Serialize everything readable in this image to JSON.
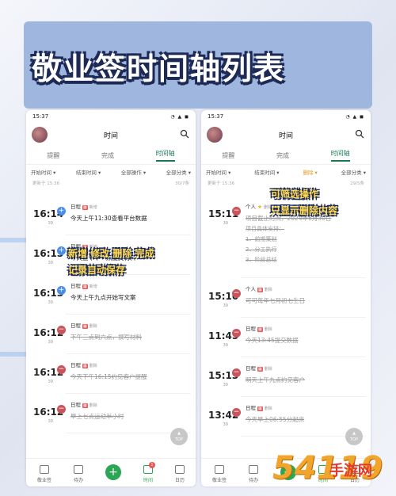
{
  "banner_title": "敬业签时间轴列表",
  "phone_left": {
    "status_time": "15:37",
    "header_title": "时间",
    "tabs": [
      "提醒",
      "完成",
      "时间轴"
    ],
    "filters": [
      "开始时间 ▾",
      "结束时间 ▾",
      "全部操作 ▾",
      "全部分类 ▾"
    ],
    "update_left": "更新于 15:36",
    "update_right": "30/7条",
    "rows": [
      {
        "time": "16:14",
        "day": "39",
        "type": "add",
        "label": "日程",
        "status": "新增",
        "text": "今天上午11:30查看平台数据"
      },
      {
        "time": "16:13",
        "day": "39",
        "type": "add",
        "label": "日程",
        "status": "新增",
        "text": "今天上午十一点提交材料"
      },
      {
        "time": "16:13",
        "day": "39",
        "type": "add",
        "label": "日程",
        "status": "新增",
        "text": "今天上午九点开始写文案"
      },
      {
        "time": "16:12",
        "day": "39",
        "type": "del",
        "label": "日程",
        "status": "删除",
        "text": "下午三点到六点，撰写材料"
      },
      {
        "time": "16:12",
        "day": "39",
        "type": "del",
        "label": "日程",
        "status": "删除",
        "text": "今天下午16:15约见客户提醒"
      },
      {
        "time": "16:12",
        "day": "39",
        "type": "del",
        "label": "日程",
        "status": "删除",
        "text": "早上七点运动半小时"
      }
    ],
    "annotation_1": "新增 修改 删除 完成",
    "annotation_2": "记录自动保存",
    "nav": [
      "敬业签",
      "待办",
      "",
      "时间",
      "日历"
    ],
    "badge": "1"
  },
  "phone_right": {
    "status_time": "15:37",
    "header_title": "时间",
    "tabs": [
      "提醒",
      "完成",
      "时间轴"
    ],
    "filters": [
      "开始时间 ▾",
      "结束时间 ▾",
      "删除 ▾",
      "全部分类 ▾"
    ],
    "update_left": "更新于 15:36",
    "update_right": "29/5条",
    "annotation_1": "可筛选操作",
    "annotation_2": "只显示删除内容",
    "first_row": {
      "time": "15:11",
      "day": "39",
      "label": "个人",
      "status": "删除",
      "text": "项目截止时间，2024年6月30日",
      "subs": [
        "项目具体安排：",
        "1、前期策划",
        "2、分工执行",
        "3、阶段总结"
      ]
    },
    "rows": [
      {
        "time": "15:10",
        "day": "39",
        "label": "个人",
        "status": "删除",
        "text": "可可每年七月初七生日"
      },
      {
        "time": "11:45",
        "day": "39",
        "label": "日程",
        "status": "删除",
        "text": "今天13:45提交数据"
      },
      {
        "time": "15:13",
        "day": "39",
        "label": "日程",
        "status": "删除",
        "text": "明天上午九点约见客户"
      },
      {
        "time": "13:42",
        "day": "39",
        "label": "日程",
        "status": "删除",
        "text": "今天早上06:55分起床"
      }
    ],
    "nav": [
      "敬业签",
      "待办",
      "",
      "时间",
      "日历"
    ]
  },
  "top_label": "TOP",
  "watermark": {
    "num": "54119",
    "cn": "手游网"
  }
}
